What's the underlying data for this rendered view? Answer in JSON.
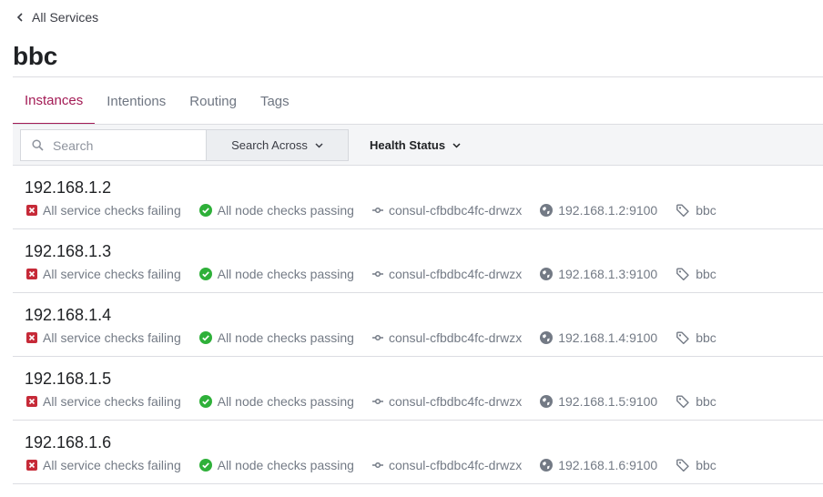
{
  "breadcrumb": {
    "label": "All Services"
  },
  "page": {
    "title": "bbc"
  },
  "tabs": [
    {
      "label": "Instances",
      "active": true
    },
    {
      "label": "Intentions",
      "active": false
    },
    {
      "label": "Routing",
      "active": false
    },
    {
      "label": "Tags",
      "active": false
    }
  ],
  "filters": {
    "search_placeholder": "Search",
    "search_value": "",
    "search_across_label": "Search Across",
    "health_status_label": "Health Status"
  },
  "colors": {
    "accent": "#a31b55",
    "failing": "#c62a38",
    "passing": "#2eb039"
  },
  "instances": [
    {
      "name": "192.168.1.2",
      "service_checks": "All service checks failing",
      "node_checks": "All node checks passing",
      "node": "consul-cfbdbc4fc-drwzx",
      "address": "192.168.1.2:9100",
      "tag": "bbc"
    },
    {
      "name": "192.168.1.3",
      "service_checks": "All service checks failing",
      "node_checks": "All node checks passing",
      "node": "consul-cfbdbc4fc-drwzx",
      "address": "192.168.1.3:9100",
      "tag": "bbc"
    },
    {
      "name": "192.168.1.4",
      "service_checks": "All service checks failing",
      "node_checks": "All node checks passing",
      "node": "consul-cfbdbc4fc-drwzx",
      "address": "192.168.1.4:9100",
      "tag": "bbc"
    },
    {
      "name": "192.168.1.5",
      "service_checks": "All service checks failing",
      "node_checks": "All node checks passing",
      "node": "consul-cfbdbc4fc-drwzx",
      "address": "192.168.1.5:9100",
      "tag": "bbc"
    },
    {
      "name": "192.168.1.6",
      "service_checks": "All service checks failing",
      "node_checks": "All node checks passing",
      "node": "consul-cfbdbc4fc-drwzx",
      "address": "192.168.1.6:9100",
      "tag": "bbc"
    }
  ]
}
